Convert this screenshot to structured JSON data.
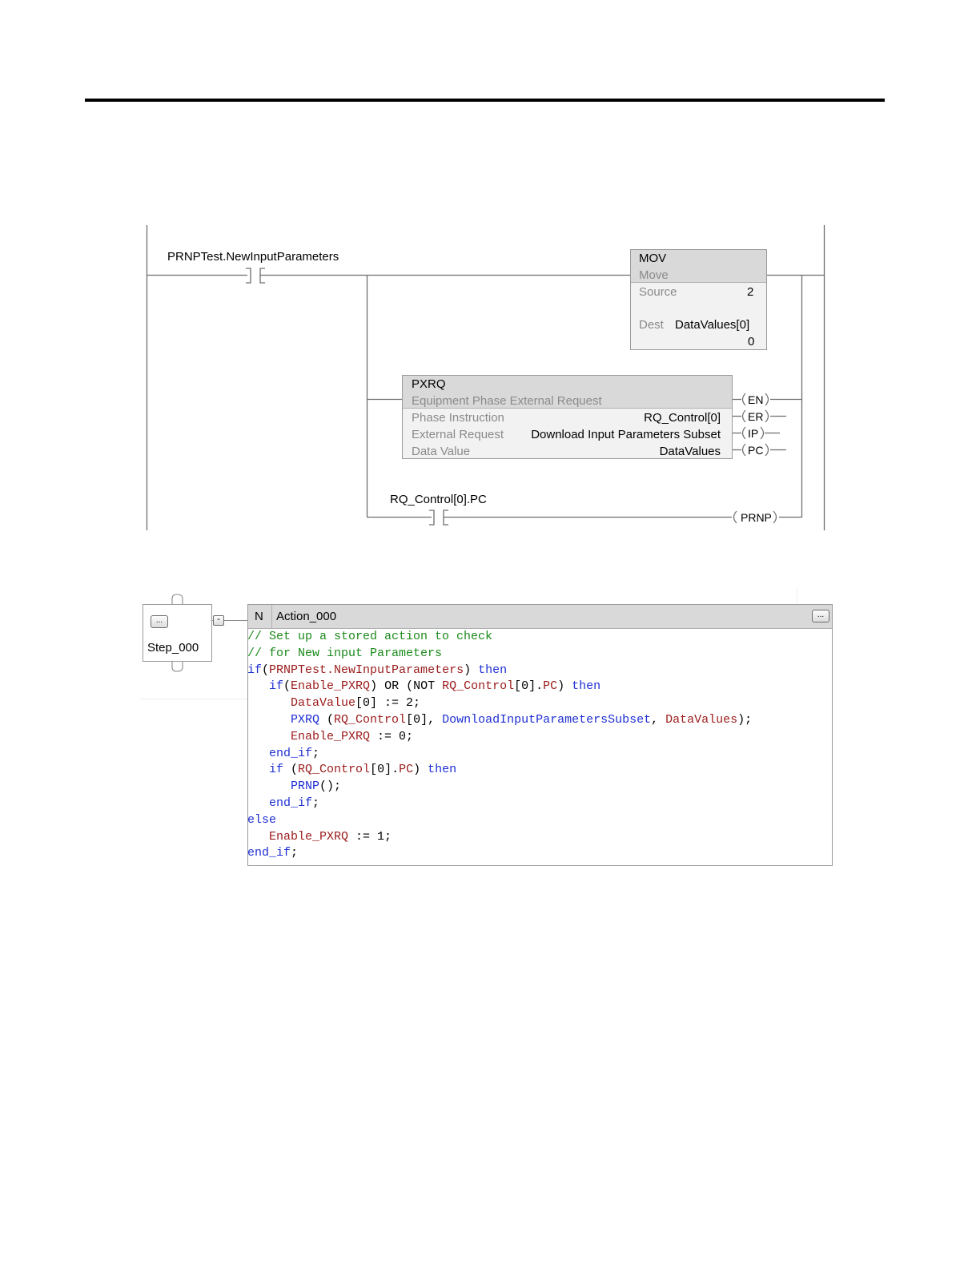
{
  "ladder": {
    "contact1_tag": "PRNPTest.NewInputParameters",
    "mov": {
      "mnemonic": "MOV",
      "desc": "Move",
      "source_label": "Source",
      "source_value": "2",
      "dest_label": "Dest",
      "dest_value": "DataValues[0]",
      "dest_live_value": "0"
    },
    "pxrq": {
      "mnemonic": "PXRQ",
      "desc": "Equipment Phase External Request",
      "rows": [
        {
          "label": "Phase Instruction",
          "value": "RQ_Control[0]"
        },
        {
          "label": "External Request",
          "value": "Download Input Parameters Subset"
        },
        {
          "label": "Data Value",
          "value": "DataValues"
        }
      ],
      "outputs": [
        "EN",
        "ER",
        "IP",
        "PC"
      ]
    },
    "contact2_tag": "RQ_Control[0].PC",
    "coil_label": "PRNP"
  },
  "sfc": {
    "step_button": "...",
    "step_name": "Step_000",
    "collapse_symbol": "-",
    "qualifier": "N",
    "action_name": "Action_000",
    "action_button": "..."
  },
  "code_lines": [
    [
      {
        "c": "cm",
        "t": "// Set up a stored action to check"
      }
    ],
    [
      {
        "c": "cm",
        "t": "// for New input Parameters"
      }
    ],
    [
      {
        "c": "kw",
        "t": "if"
      },
      {
        "c": "tx",
        "t": "("
      },
      {
        "c": "tag",
        "t": "PRNPTest.NewInputParameters"
      },
      {
        "c": "tx",
        "t": ") "
      },
      {
        "c": "kw",
        "t": "then"
      }
    ],
    [
      {
        "c": "tx",
        "t": "   "
      },
      {
        "c": "kw",
        "t": "if"
      },
      {
        "c": "tx",
        "t": "("
      },
      {
        "c": "tag",
        "t": "Enable_PXRQ"
      },
      {
        "c": "tx",
        "t": ") OR (NOT "
      },
      {
        "c": "tag",
        "t": "RQ_Control"
      },
      {
        "c": "tx",
        "t": "[0]."
      },
      {
        "c": "tag",
        "t": "PC"
      },
      {
        "c": "tx",
        "t": ") "
      },
      {
        "c": "kw",
        "t": "then"
      }
    ],
    [
      {
        "c": "tx",
        "t": "      "
      },
      {
        "c": "tag",
        "t": "DataValue"
      },
      {
        "c": "tx",
        "t": "[0] := 2;"
      }
    ],
    [
      {
        "c": "tx",
        "t": "      "
      },
      {
        "c": "kw",
        "t": "PXRQ"
      },
      {
        "c": "tx",
        "t": " ("
      },
      {
        "c": "tag",
        "t": "RQ_Control"
      },
      {
        "c": "tx",
        "t": "[0], "
      },
      {
        "c": "kw",
        "t": "DownloadInputParametersSubset"
      },
      {
        "c": "tx",
        "t": ", "
      },
      {
        "c": "tag",
        "t": "DataValues"
      },
      {
        "c": "tx",
        "t": ");"
      }
    ],
    [
      {
        "c": "tx",
        "t": "      "
      },
      {
        "c": "tag",
        "t": "Enable_PXRQ"
      },
      {
        "c": "tx",
        "t": " := 0;"
      }
    ],
    [
      {
        "c": "tx",
        "t": "   "
      },
      {
        "c": "kw",
        "t": "end_if"
      },
      {
        "c": "tx",
        "t": ";"
      }
    ],
    [
      {
        "c": "tx",
        "t": "   "
      },
      {
        "c": "kw",
        "t": "if"
      },
      {
        "c": "tx",
        "t": " ("
      },
      {
        "c": "tag",
        "t": "RQ_Control"
      },
      {
        "c": "tx",
        "t": "[0]."
      },
      {
        "c": "tag",
        "t": "PC"
      },
      {
        "c": "tx",
        "t": ") "
      },
      {
        "c": "kw",
        "t": "then"
      }
    ],
    [
      {
        "c": "tx",
        "t": "      "
      },
      {
        "c": "kw",
        "t": "PRNP"
      },
      {
        "c": "tx",
        "t": "();"
      }
    ],
    [
      {
        "c": "tx",
        "t": "   "
      },
      {
        "c": "kw",
        "t": "end_if"
      },
      {
        "c": "tx",
        "t": ";"
      }
    ],
    [
      {
        "c": "kw",
        "t": "else"
      }
    ],
    [
      {
        "c": "tx",
        "t": "   "
      },
      {
        "c": "tag",
        "t": "Enable_PXRQ"
      },
      {
        "c": "tx",
        "t": " := 1;"
      }
    ],
    [
      {
        "c": "kw",
        "t": "end_if"
      },
      {
        "c": "tx",
        "t": ";"
      }
    ]
  ]
}
